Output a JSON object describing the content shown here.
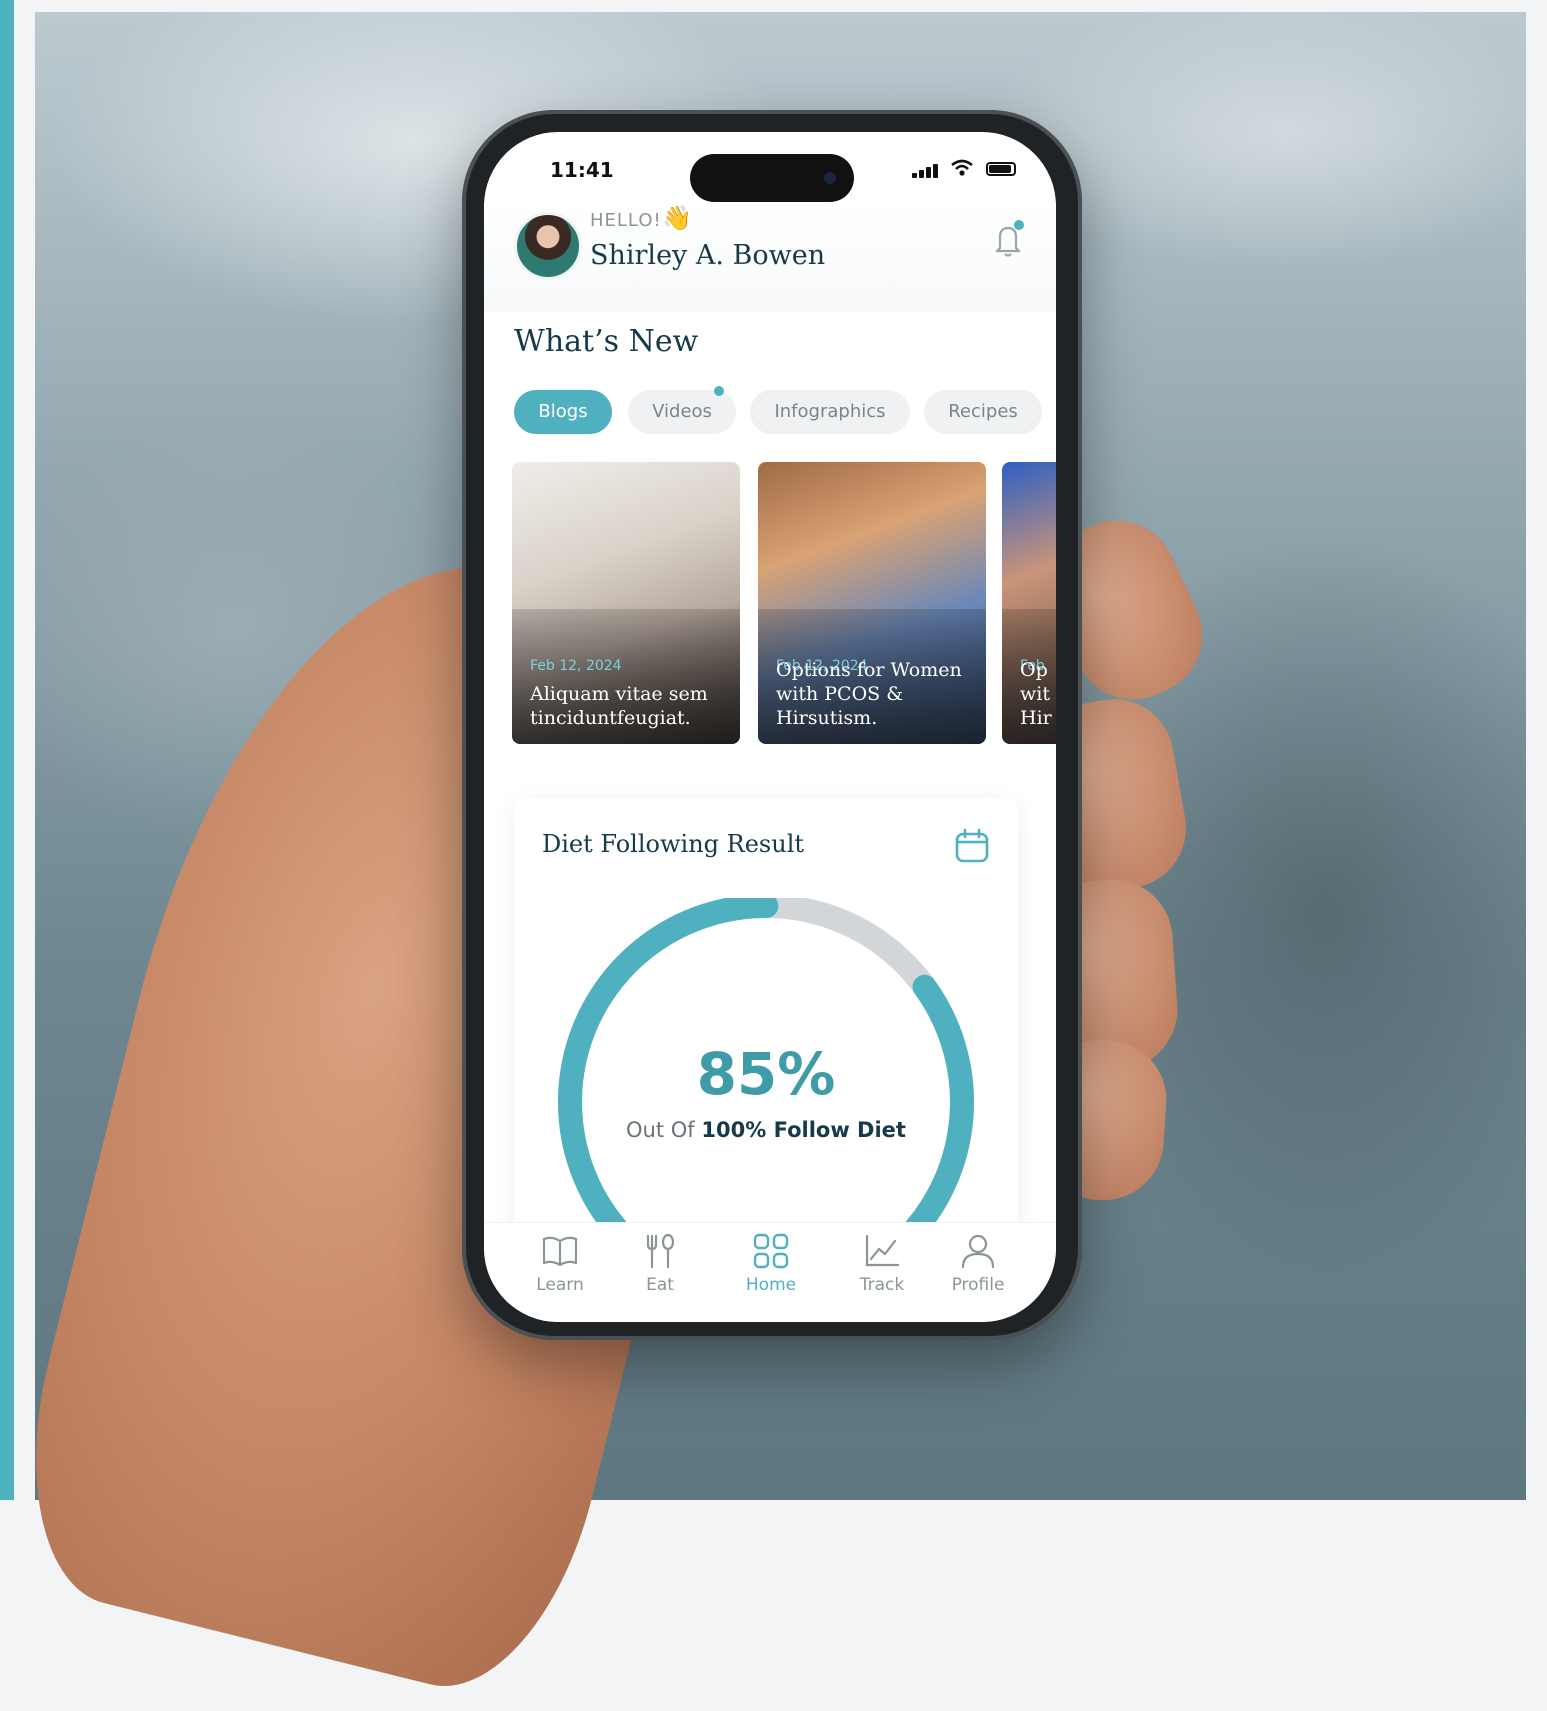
{
  "status_bar": {
    "time": "11:41"
  },
  "header": {
    "greeting": "HELLO!",
    "wave_emoji": "👋",
    "user_name": "Shirley A. Bowen"
  },
  "whats_new": {
    "title": "What’s New",
    "tabs": [
      {
        "label": "Blogs",
        "active": true
      },
      {
        "label": "Videos",
        "active": false,
        "has_new": true
      },
      {
        "label": "Infographics",
        "active": false
      },
      {
        "label": "Recipes",
        "active": false
      }
    ],
    "cards": [
      {
        "date": "Feb 12, 2024",
        "title": "Aliquam vitae sem tinciduntfeugiat."
      },
      {
        "date": "Feb 12, 2024",
        "title": "Options for Women with PCOS & Hirsutism."
      },
      {
        "date": "Feb",
        "title": "Op wit Hir"
      }
    ]
  },
  "diet_result": {
    "title": "Diet Following Result",
    "percent_text": "85%",
    "percent_value": 85,
    "subtitle_prefix": "Out Of",
    "subtitle_bold": "100% Follow Diet"
  },
  "tab_bar": {
    "items": [
      {
        "label": "Learn",
        "icon": "book-icon",
        "active": false
      },
      {
        "label": "Eat",
        "icon": "fork-spoon-icon",
        "active": false
      },
      {
        "label": "Home",
        "icon": "grid-icon",
        "active": true
      },
      {
        "label": "Track",
        "icon": "chart-icon",
        "active": false
      },
      {
        "label": "Profile",
        "icon": "user-icon",
        "active": false
      }
    ]
  },
  "colors": {
    "accent": "#4fb0bf",
    "navy_text": "#163a4a",
    "inactive_tab": "#eff1f2",
    "gauge_track": "#d3d6d8"
  }
}
